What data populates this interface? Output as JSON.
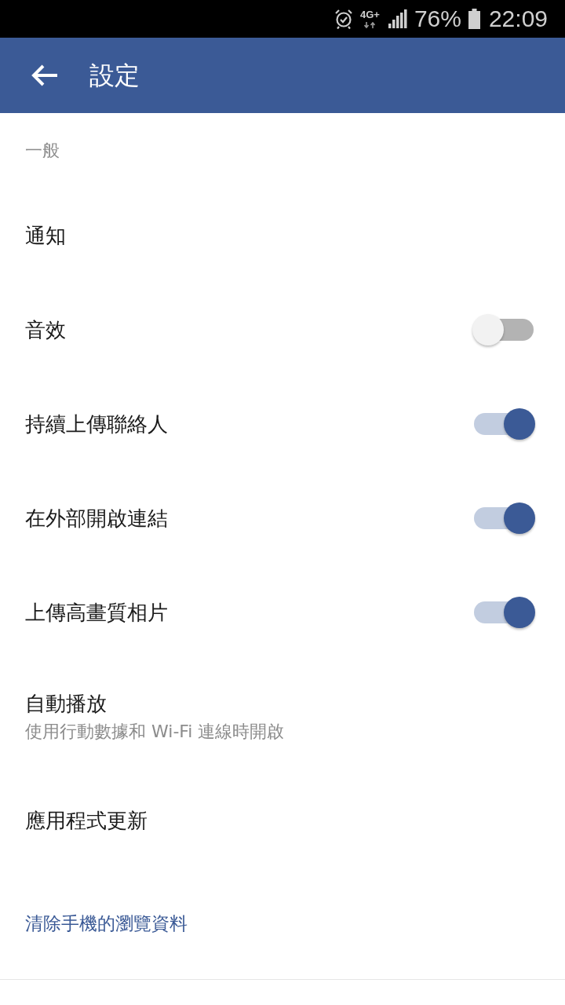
{
  "status_bar": {
    "network": "4G+",
    "battery": "76%",
    "time": "22:09"
  },
  "app_bar": {
    "title": "設定"
  },
  "section": {
    "title": "一般"
  },
  "items": [
    {
      "kind": "plain",
      "label": "通知"
    },
    {
      "kind": "toggle",
      "label": "音效",
      "on": false
    },
    {
      "kind": "toggle",
      "label": "持續上傳聯絡人",
      "on": true
    },
    {
      "kind": "toggle",
      "label": "在外部開啟連結",
      "on": true
    },
    {
      "kind": "toggle",
      "label": "上傳高畫質相片",
      "on": true
    },
    {
      "kind": "plain",
      "label": "自動播放",
      "subtitle": "使用行動數據和 Wi-Fi 連線時開啟"
    },
    {
      "kind": "plain",
      "label": "應用程式更新"
    },
    {
      "kind": "link",
      "label": "清除手機的瀏覽資料"
    }
  ]
}
